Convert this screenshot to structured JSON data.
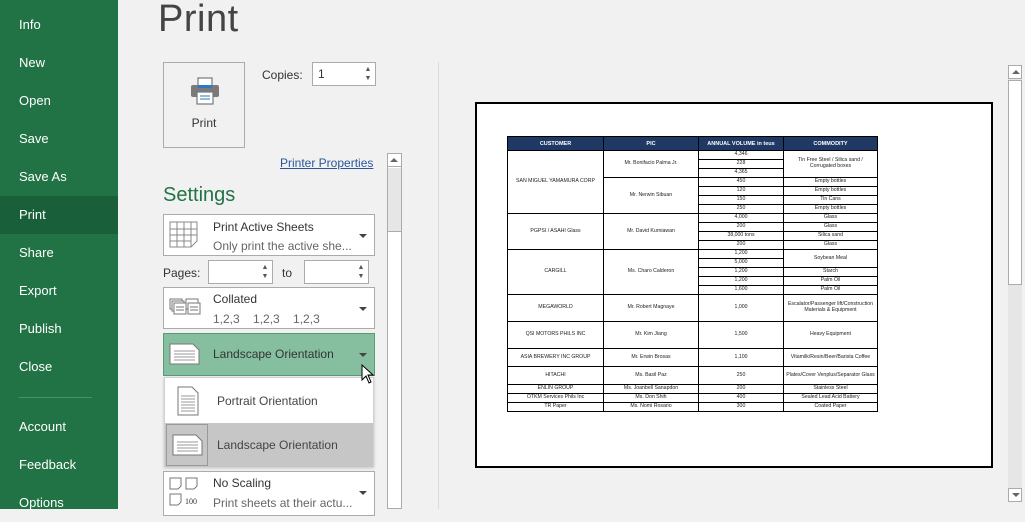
{
  "sidebar": {
    "items": [
      {
        "label": "Info",
        "active": false
      },
      {
        "label": "New",
        "active": false
      },
      {
        "label": "Open",
        "active": false
      },
      {
        "label": "Save",
        "active": false
      },
      {
        "label": "Save As",
        "active": false
      },
      {
        "label": "Print",
        "active": true
      },
      {
        "label": "Share",
        "active": false
      },
      {
        "label": "Export",
        "active": false
      },
      {
        "label": "Publish",
        "active": false
      },
      {
        "label": "Close",
        "active": false
      },
      {
        "label": "Account",
        "active": false
      },
      {
        "label": "Feedback",
        "active": false
      },
      {
        "label": "Options",
        "active": false
      }
    ]
  },
  "page_title": "Print",
  "print_button": {
    "label": "Print",
    "icon": "printer-icon"
  },
  "copies": {
    "label": "Copies:",
    "value": "1"
  },
  "printer_properties_link": "Printer Properties",
  "settings": {
    "heading": "Settings",
    "print_what": {
      "title": "Print Active Sheets",
      "subtitle": "Only print the active she..."
    },
    "pages": {
      "label": "Pages:",
      "from_value": "",
      "to_label": "to",
      "to_value": ""
    },
    "collation": {
      "title": "Collated",
      "subtitle": "1,2,3    1,2,3    1,2,3"
    },
    "orientation": {
      "title": "Landscape Orientation",
      "color": "#86bf9f"
    },
    "orientation_options": [
      {
        "label": "Portrait Orientation",
        "selected": false
      },
      {
        "label": "Landscape Orientation",
        "selected": true
      }
    ],
    "scaling": {
      "title": "No Scaling",
      "subtitle": "Print sheets at their actu...",
      "icon_text": "100"
    }
  },
  "preview": {
    "headers": [
      "CUSTOMER",
      "PIC",
      "ANNUAL VOLUME in teus",
      "COMMODITY"
    ],
    "groups": [
      {
        "customer": "SAN MIGUEL YAMAMURA CORP",
        "pics": [
          {
            "name": "Mr. Bonifacio Palma Jr.",
            "rows": [
              {
                "volume": "4,346",
                "commodity": "Tin Free Steel / Silica sand / Corrugated boxes",
                "span": 3
              },
              {
                "volume": "228"
              },
              {
                "volume": "4,365"
              }
            ]
          },
          {
            "name": "Mr. Nerwin Sibuan",
            "rows": [
              {
                "volume": "450",
                "commodity": "Empty bottles"
              },
              {
                "volume": "120",
                "commodity": "Empty bottles"
              },
              {
                "volume": "150",
                "commodity": "Tin Cans"
              },
              {
                "volume": "250",
                "commodity": "Empty bottles"
              }
            ]
          }
        ]
      },
      {
        "customer": "PGPSI / ASAHI Glass",
        "pics": [
          {
            "name": "Mr. David Kurniawan",
            "rows": [
              {
                "volume": "4,000",
                "commodity": "Glass"
              },
              {
                "volume": "200",
                "commodity": "Glass"
              },
              {
                "volume": "38,000 tons",
                "commodity": "Silica sand"
              },
              {
                "volume": "200",
                "commodity": "Glass"
              }
            ]
          }
        ]
      },
      {
        "customer": "CARGILL",
        "pics": [
          {
            "name": "Ms. Charo Calderon",
            "rows": [
              {
                "volume": "1,200",
                "commodity": "Soybean Meal",
                "span": 2
              },
              {
                "volume": "5,000"
              },
              {
                "volume": "1,200",
                "commodity": "Starch"
              },
              {
                "volume": "1,200",
                "commodity": "Palm Oil"
              },
              {
                "volume": "1,600",
                "commodity": "Palm Oil"
              }
            ]
          }
        ]
      },
      {
        "customer": "MEGAWORLD",
        "pics": [
          {
            "name": "Mr. Robert Magnaye",
            "rows": [
              {
                "volume": "1,000",
                "commodity": "Escalator/Passenger lift/Construction Materials & Equipment",
                "tall": 3
              }
            ]
          }
        ]
      },
      {
        "customer": "QSI MOTORS PHILS INC",
        "pics": [
          {
            "name": "Mr. Kim Jiang",
            "rows": [
              {
                "volume": "1,500",
                "commodity": "Heavy Equipment",
                "tall": 3
              }
            ]
          }
        ]
      },
      {
        "customer": "ASIA BREWERY INC GROUP",
        "pics": [
          {
            "name": "Mr. Erwin Brosas",
            "rows": [
              {
                "volume": "1,100",
                "commodity": "Vitamilk/Resin/Beer/Barista Coffee",
                "tall": 2
              }
            ]
          }
        ]
      },
      {
        "customer": "HITACHI",
        "pics": [
          {
            "name": "Ms. Basil Paz",
            "rows": [
              {
                "volume": "250",
                "commodity": "Plates/Cover Venplus/Separator Glass",
                "tall": 2
              }
            ]
          }
        ]
      },
      {
        "customer": "ENLIN GROUP",
        "pics": [
          {
            "name": "Ms. Joanbell Sanapdon",
            "rows": [
              {
                "volume": "200",
                "commodity": "Stainless Steel"
              }
            ]
          }
        ]
      },
      {
        "customer": "OTKM Services Phils Inc",
        "pics": [
          {
            "name": "Ms. Don Shih",
            "rows": [
              {
                "volume": "400",
                "commodity": "Sealed Lead Acid Battery"
              }
            ]
          }
        ]
      },
      {
        "customer": "TR Paper",
        "pics": [
          {
            "name": "Ms. Nomi Rosario",
            "rows": [
              {
                "volume": "300",
                "commodity": "Coated Paper"
              }
            ]
          }
        ]
      }
    ]
  }
}
